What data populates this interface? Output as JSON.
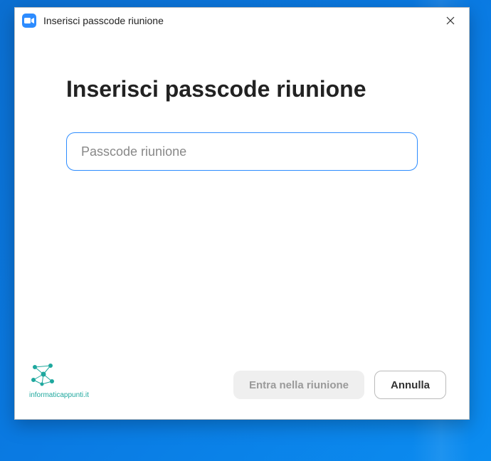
{
  "window": {
    "title": "Inserisci passcode riunione"
  },
  "content": {
    "heading": "Inserisci passcode riunione",
    "passcode_placeholder": "Passcode riunione",
    "passcode_value": ""
  },
  "buttons": {
    "join": "Entra nella riunione",
    "cancel": "Annulla"
  },
  "watermark": {
    "text": "informaticappunti.it"
  }
}
